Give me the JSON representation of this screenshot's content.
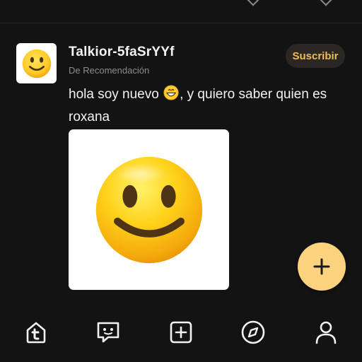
{
  "post": {
    "username": "Talkior-5faSrYYf",
    "source": "De Recomendación",
    "subscribe_label": "Suscribir",
    "text_before": "hola soy nuevo ",
    "text_after": ", y quiero saber quien es roxana",
    "text_emoji": "grinning-face-emoji",
    "avatar_icon": "slightly-smiling-face-icon",
    "image_icon": "smiling-face-icon"
  },
  "fab": {
    "icon": "plus-icon",
    "color": "#fbd27e"
  },
  "bottom_nav": [
    {
      "icon": "home-t-icon"
    },
    {
      "icon": "chat-bubble-icon"
    },
    {
      "icon": "add-square-icon"
    },
    {
      "icon": "compass-icon"
    },
    {
      "icon": "profile-icon"
    }
  ],
  "colors": {
    "background": "#131313",
    "accent": "#f2bc55",
    "muted_text": "#8d8d8d"
  }
}
